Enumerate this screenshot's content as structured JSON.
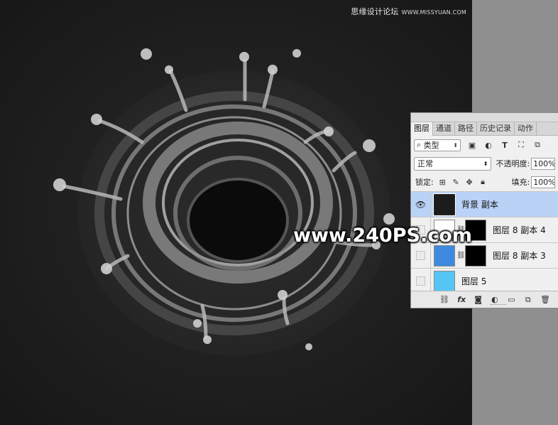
{
  "site_mark": {
    "cn": "思缘设计论坛",
    "url": "WWW.MISSYUAN.COM"
  },
  "watermark": "www.240PS.com",
  "panel": {
    "tabs": [
      "图层",
      "通道",
      "路径",
      "历史记录",
      "动作"
    ],
    "active_tab": "图层",
    "filter": {
      "label": "类型",
      "icon": "search-icon"
    },
    "filter_icons": [
      "image-icon",
      "adjustment-icon",
      "type-icon",
      "shape-icon",
      "smart-object-icon"
    ],
    "blend_mode": "正常",
    "opacity_label": "不透明度:",
    "opacity_value": "100%",
    "lock_label": "锁定:",
    "fill_label": "填充:",
    "fill_value": "100%",
    "layers": [
      {
        "name": "背景 副本",
        "visible": true,
        "selected": true,
        "thumb": "dark"
      },
      {
        "name": "图层 8 副本 4",
        "visible": false,
        "selected": false,
        "thumb": "white",
        "mask": true
      },
      {
        "name": "图层 8 副本 3",
        "visible": false,
        "selected": false,
        "thumb": "blue",
        "mask": true
      },
      {
        "name": "图层 5",
        "visible": false,
        "selected": false,
        "thumb": "cyan"
      }
    ],
    "footer_icons": [
      "link-icon",
      "fx-icon",
      "mask-icon",
      "adjustment-layer-icon",
      "folder-icon",
      "new-layer-icon",
      "trash-icon"
    ],
    "fx_label": "fx"
  },
  "colors": {
    "selected_row": "#b9d2f6",
    "blue_thumb": "#3f8ae0",
    "cyan_thumb": "#55c5f5"
  }
}
